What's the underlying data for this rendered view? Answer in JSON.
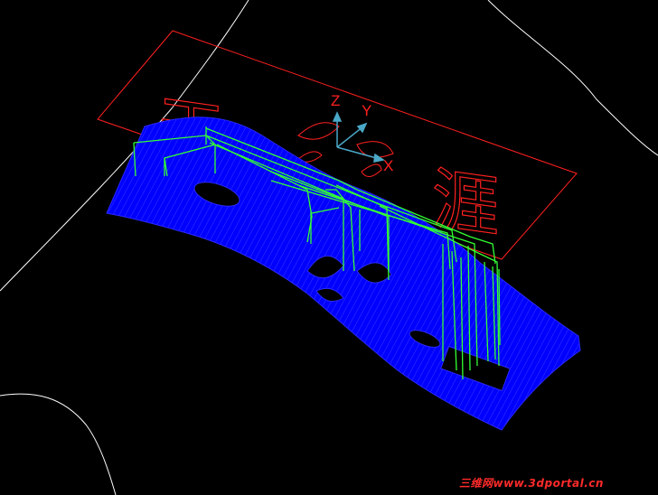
{
  "viewport": {
    "background": "#000000",
    "colors": {
      "sheet": "#0000ff",
      "sheet_lines": "#3a3aff",
      "toolpath": "#33ff33",
      "boundary": "#ff2020",
      "axis": "#4aa8c8",
      "edge_curves": "#ffffff",
      "watermark": "#ff2a2a"
    },
    "axes": {
      "z": "Z",
      "y": "Y",
      "x": "X"
    },
    "engraving": {
      "char_left": "天",
      "char_right": "涯"
    }
  },
  "watermark": {
    "text": "三维网www.3dportal.cn"
  }
}
